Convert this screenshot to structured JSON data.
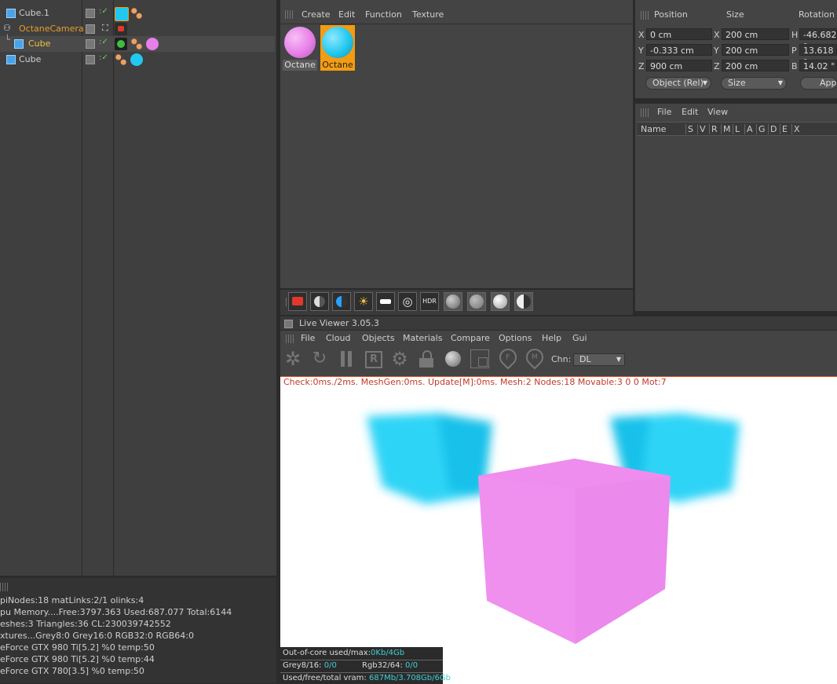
{
  "objects": [
    {
      "name": "Cube.1",
      "color": "#cfcfcf"
    },
    {
      "name": "OctaneCamera",
      "color": "#e89c2a"
    },
    {
      "name": "Cube",
      "color": "#f3c23a"
    },
    {
      "name": "Cube",
      "color": "#cfcfcf"
    }
  ],
  "material_menu": {
    "create": "Create",
    "edit": "Edit",
    "function": "Function",
    "texture": "Texture"
  },
  "materials": [
    {
      "label": "Octane",
      "color": "#e77fe8",
      "selected": false
    },
    {
      "label": "Octane",
      "color": "#22c8ef",
      "selected": true
    }
  ],
  "coords": {
    "headers": {
      "position": "Position",
      "size": "Size",
      "rotation": "Rotation"
    },
    "rows": [
      {
        "axis": "X",
        "pos": "0 cm",
        "saxis": "X",
        "size": "200 cm",
        "raxis": "H",
        "rot": "-46.682 °"
      },
      {
        "axis": "Y",
        "pos": "-0.333 cm",
        "saxis": "Y",
        "size": "200 cm",
        "raxis": "P",
        "rot": "13.618 °"
      },
      {
        "axis": "Z",
        "pos": "900 cm",
        "saxis": "Z",
        "size": "200 cm",
        "raxis": "B",
        "rot": "14.02 °"
      }
    ],
    "mode": "Object (Rel)",
    "size_mode": "Size",
    "apply": "Apply"
  },
  "layer_menu": {
    "file": "File",
    "edit": "Edit",
    "view": "View"
  },
  "layer_columns": {
    "name": "Name",
    "flags": [
      "S",
      "V",
      "R",
      "M",
      "L",
      "A",
      "G",
      "D",
      "E",
      "X"
    ]
  },
  "live_viewer": {
    "title": "Live Viewer 3.05.3",
    "menu": [
      "File",
      "Cloud",
      "Objects",
      "Materials",
      "Compare",
      "Options",
      "Help",
      "Gui"
    ],
    "channel_label": "Chn:",
    "channel_value": "DL",
    "status": "Check:0ms./2ms. MeshGen:0ms. Update[M]:0ms. Mesh:2 Nodes:18 Movable:3  0 0 Mot:7",
    "overlay": [
      {
        "label": "Out-of-core used/max:",
        "value": "0Kb/4Gb"
      },
      {
        "label": "Grey8/16: ",
        "value": "0/0",
        "label2": "Rgb32/64: ",
        "value2": "0/0"
      },
      {
        "label": "Used/free/total vram: ",
        "value": "687Mb/3.708Gb/6Gb"
      }
    ]
  },
  "stats": [
    "piNodes:18  matLinks:2/1  olinks:4",
    "pu Memory....Free:3797.363 Used:687.077 Total:6144",
    "eshes:3 Triangles:36 CL:230039742552",
    "xtures...Grey8:0  Grey16:0  RGB32:0  RGB64:0",
    "eForce GTX 980 Ti[5.2] %0 temp:50",
    "eForce GTX 980 Ti[5.2] %0 temp:44",
    "eForce GTX 780[3.5] %0 temp:50"
  ],
  "colors": {
    "accent": "#f39c12",
    "cyan": "#22c8ef",
    "pink": "#ef8fee",
    "status_text": "#e84d22",
    "overlay_value": "#3fd0d8"
  }
}
